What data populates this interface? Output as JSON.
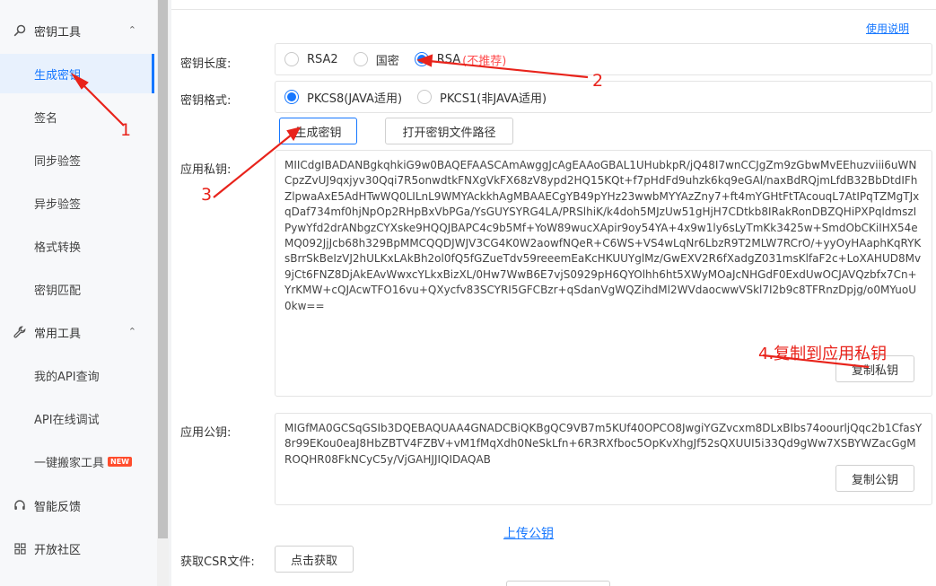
{
  "sidebar": {
    "key_tools": {
      "label": "密钥工具"
    },
    "items": [
      {
        "label": "生成密钥"
      },
      {
        "label": "签名"
      },
      {
        "label": "同步验签"
      },
      {
        "label": "异步验签"
      },
      {
        "label": "格式转换"
      },
      {
        "label": "密钥匹配"
      }
    ],
    "common_tools": {
      "label": "常用工具"
    },
    "common_items": [
      {
        "label": "我的API查询"
      },
      {
        "label": "API在线调试"
      },
      {
        "label": "一键搬家工具",
        "badge": "NEW"
      }
    ],
    "feedback": {
      "label": "智能反馈"
    },
    "community": {
      "label": "开放社区"
    }
  },
  "main": {
    "usage_link": "使用说明",
    "key_length": {
      "label": "密钥长度:",
      "options": [
        "RSA2",
        "国密",
        "RSA"
      ],
      "rsa_note": "(不推荐)",
      "selected": "RSA"
    },
    "key_format": {
      "label": "密钥格式:",
      "options": [
        "PKCS8(JAVA适用)",
        "PKCS1(非JAVA适用)"
      ],
      "selected": "PKCS8(JAVA适用)"
    },
    "generate_button": "生成密钥",
    "open_path_button": "打开密钥文件路径",
    "private_key": {
      "label": "应用私钥:",
      "value": "MIICdgIBADANBgkqhkiG9w0BAQEFAASCAmAwggJcAgEAAoGBAL1UHubkpR/jQ48I7wnCCJgZm9zGbwMvEEhuzviii6uWNCpzZvUJ9qxjyv30Qqi7R5onwdtkFNXgVkFX68zV8ypd2HQ15KQt+f7pHdFd9uhzk6kq9eGAl/naxBdRQjmLfdB32BbDtdIFhZlpwaAxE5AdHTwWQ0LILnL9WMYAckkhAgMBAAECgYB49pYHz23wwbMYYAzZny7+ft4mYGHtFtTAcouqL7AtIPqTZMgTJxqDaf734mf0hjNpOp2RHpBxVbPGa/YsGUYSYRG4LA/PRSlhiK/k4doh5MJzUw51gHjH7CDtkb8IRakRonDBZQHiPXPqldmszIPywYfd2drANbgzCYXske9HQQJBAPC4c9b5Mf+YoW89wucXApir9oy54YA+4x9w1ly6sLyTmKk3425w+SmdObCKiIHX54eMQ092JjJcb68h329BpMMCQQDJWJV3CG4K0W2aowfNQeR+C6WS+VS4wLqNr6LbzR9T2MLW7RCrO/+yyOyHAaphKqRYKsBrrSkBeIzVJ2hULKxLAkBh2ol0fQ5fGZueTdv59reeemEaKcHKUUYglMz/GwEXV2R6fXadgZ031msKlfaF2c+LoXAHUD8Mv9jCt6FNZ8DjAkEAvWwxcYLkxBizXL/0Hw7WwB6E7vjS0929pH6QYOlhh6ht5XWyMOaJcNHGdF0ExdUwOCJAVQzbfx7Cn+YrKMW+cQJAcwTFO16vu+QXycfv83SCYRI5GFCBzr+qSdanVgWQZihdMl2WVdaocwwVSkl7I2b9c8TFRnzDpjg/o0MYuoU0kw==",
      "copy_button": "复制私钥"
    },
    "public_key": {
      "label": "应用公钥:",
      "value": "MIGfMA0GCSqGSIb3DQEBAQUAA4GNADCBiQKBgQC9VB7m5KUf40OPCO8JwgiYGZvcxm8DLxBIbs74oourljQqc2b1CfasY8r99EKou0eaJ8HbZBTV4FZBV+vM1fMqXdh0NeSkLfn+6R3RXfboc5OpKvXhgJf52sQXUUI5i33Qd9gWw7XSBYWZacGgMROQHR08FkNCyC5y/VjGAHJJIQIDAQAB",
      "copy_button": "复制公钥"
    },
    "upload_link": "上传公钥",
    "csr": {
      "label": "获取CSR文件:",
      "button": "点击获取"
    }
  },
  "annotations": {
    "n1": "1",
    "n2": "2",
    "n3": "3",
    "step4": "4.复制到应用私钥",
    "color": "#e8231b"
  },
  "colors": {
    "accent": "#1677ff",
    "danger": "#ff4d4f",
    "badge": "#ff4d2d"
  }
}
